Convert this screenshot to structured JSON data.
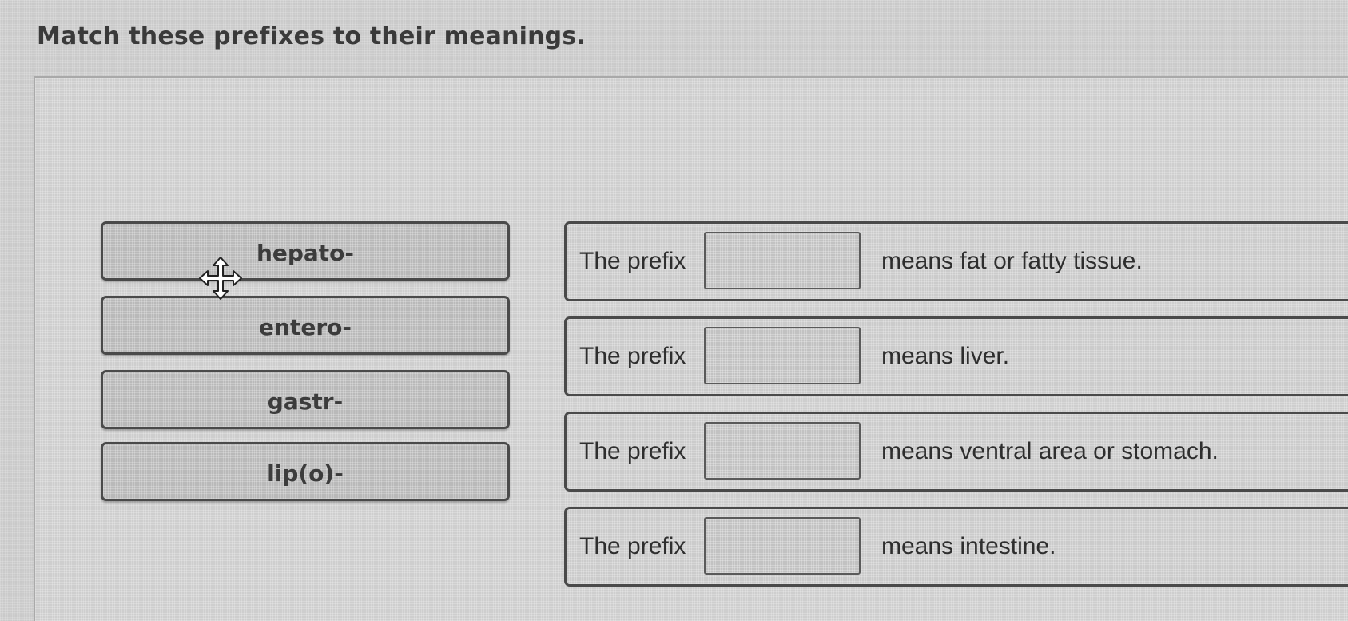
{
  "question": {
    "title": "Match these prefixes to their meanings."
  },
  "prefixes": [
    {
      "label": "hepato-"
    },
    {
      "label": "entero-"
    },
    {
      "label": "gastr-"
    },
    {
      "label": "lip(o)-"
    }
  ],
  "statements": [
    {
      "prefix_text": "The prefix",
      "meaning_text": "means fat or fatty tissue."
    },
    {
      "prefix_text": "The prefix",
      "meaning_text": "means liver."
    },
    {
      "prefix_text": "The prefix",
      "meaning_text": "means ventral area or stomach."
    },
    {
      "prefix_text": "The prefix",
      "meaning_text": "means intestine."
    }
  ],
  "cursor": {
    "icon": "move-cursor-icon"
  }
}
